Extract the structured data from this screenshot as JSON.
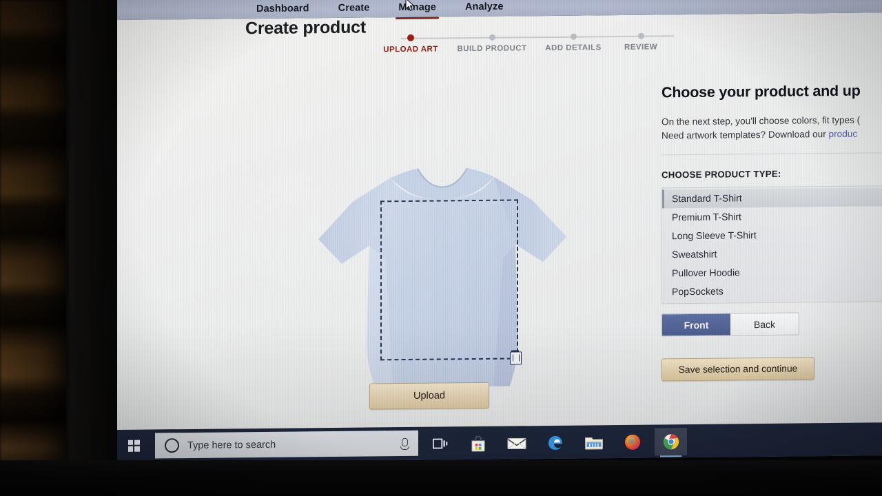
{
  "browser": {
    "nav_items": [
      {
        "label": "Dashboard",
        "active": false
      },
      {
        "label": "Create",
        "active": false
      },
      {
        "label": "Manage",
        "active": true
      },
      {
        "label": "Analyze",
        "active": false
      }
    ]
  },
  "page": {
    "title": "Create product",
    "stepper": {
      "steps": [
        {
          "label": "UPLOAD ART",
          "state": "active"
        },
        {
          "label": "BUILD PRODUCT",
          "state": "pending"
        },
        {
          "label": "ADD DETAILS",
          "state": "pending"
        },
        {
          "label": "REVIEW",
          "state": "pending"
        }
      ]
    },
    "stage": {
      "upload_button_label": "Upload",
      "print_area_name": "print-area",
      "delete_icon_name": "trash-icon"
    },
    "right_panel": {
      "heading": "Choose your product and up",
      "description_line1": "On the next step, you'll choose colors, fit types (",
      "description_line2_prefix": "Need artwork templates? Download our ",
      "description_line2_link": "produc",
      "product_type_label": "CHOOSE PRODUCT TYPE:",
      "product_types": [
        {
          "label": "Standard T-Shirt",
          "selected": true
        },
        {
          "label": "Premium T-Shirt",
          "selected": false
        },
        {
          "label": "Long Sleeve T-Shirt",
          "selected": false
        },
        {
          "label": "Sweatshirt",
          "selected": false
        },
        {
          "label": "Pullover Hoodie",
          "selected": false
        },
        {
          "label": "PopSockets",
          "selected": false
        }
      ],
      "side_toggle": [
        {
          "label": "Front",
          "active": true
        },
        {
          "label": "Back",
          "active": false
        }
      ],
      "save_button_label": "Save selection and continue"
    }
  },
  "taskbar": {
    "start_name": "start-button",
    "search_placeholder": "Type here to search",
    "icons": [
      {
        "name": "task-view-icon",
        "label": "Task View",
        "active": false
      },
      {
        "name": "microsoft-store-icon",
        "label": "Microsoft Store",
        "active": false
      },
      {
        "name": "mail-icon",
        "label": "Mail",
        "active": false
      },
      {
        "name": "edge-icon",
        "label": "Microsoft Edge",
        "active": false
      },
      {
        "name": "file-explorer-icon",
        "label": "File Explorer",
        "active": false
      },
      {
        "name": "firefox-icon",
        "label": "Firefox",
        "active": false
      },
      {
        "name": "chrome-icon",
        "label": "Google Chrome",
        "active": true
      }
    ]
  },
  "colors": {
    "nav_bar": "#b3bad0",
    "active_tab_underline": "#7c2b20",
    "step_active": "#8c2416",
    "step_dot_active": "#9b1f13",
    "link": "#4e5fa8",
    "front_button_active": "#4b5c8e",
    "save_button": "#e4d2ae",
    "upload_button": "#e6d4b3",
    "taskbar": "#1a2134"
  }
}
